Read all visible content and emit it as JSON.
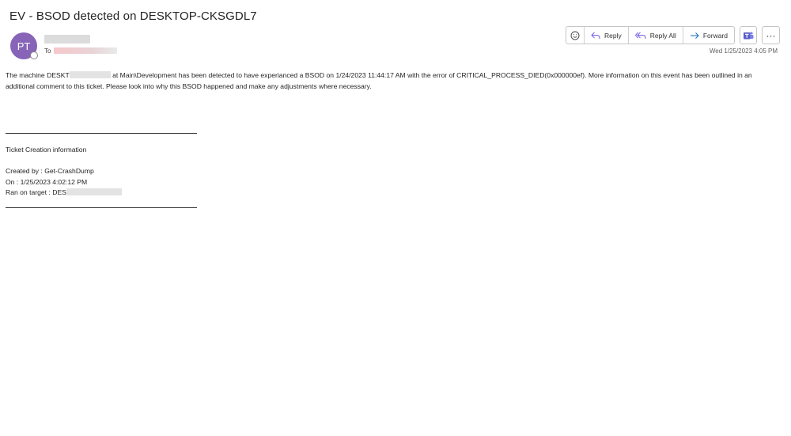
{
  "email": {
    "subject": "EV - BSOD detected on DESKTOP-CKSGDL7",
    "sender_initials": "PT",
    "to_label": "To",
    "timestamp": "Wed 1/25/2023 4:05 PM"
  },
  "toolbar": {
    "reply_label": "Reply",
    "reply_all_label": "Reply All",
    "forward_label": "Forward",
    "more_label": "···"
  },
  "message": {
    "part1": "The machine DESKT",
    "part2": " at Main\\Development has been detected to have experianced a BSOD on 1/24/2023 11:44:17 AM with the error of CRITICAL_PROCESS_DIED(0x000000ef). More information on this event has been outlined in an additional comment to this ticket. Please look into why this BSOD happened and make any adjustments where necessary.",
    "ticket_heading": "Ticket Creation information",
    "created_by": "Created by : Get-CrashDump",
    "created_on": "On : 1/25/2023 4:02:12 PM",
    "ran_on_target": "Ran on target : DES"
  },
  "colors": {
    "avatar": "#8764b8",
    "reply_icon": "#7160e8",
    "forward_icon": "#0f6cbd",
    "teams": "#5b5fc7"
  }
}
